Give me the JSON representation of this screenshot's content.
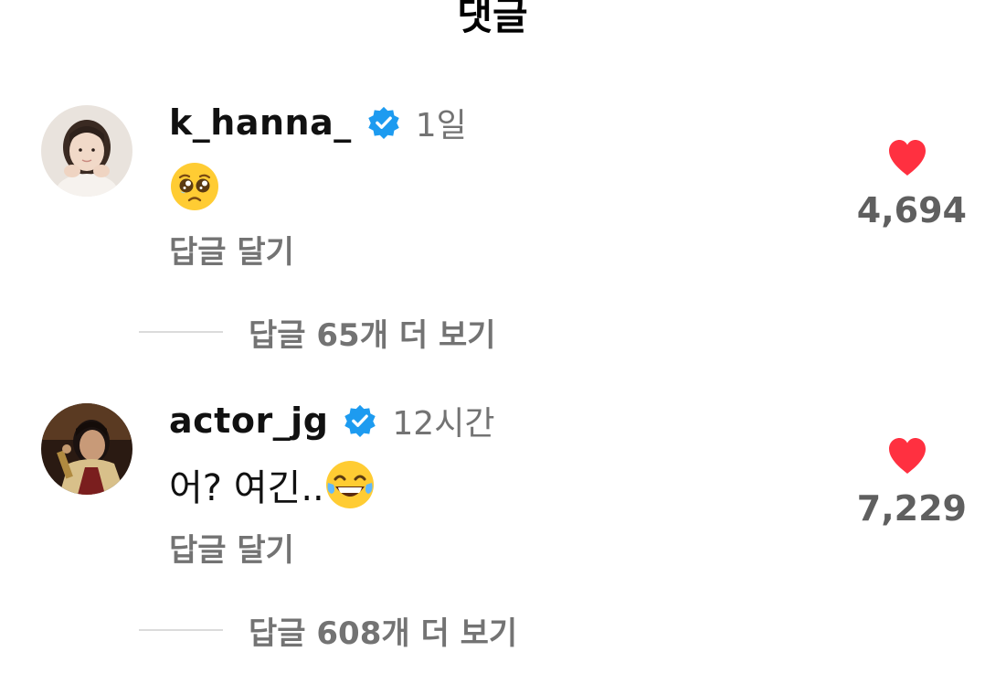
{
  "header": {
    "title": "댓글"
  },
  "comments": [
    {
      "username": "k_hanna_",
      "time": "1일",
      "text": "",
      "emoji": "pleading-face-emoji",
      "reply_label": "답글 달기",
      "likes": "4,694",
      "more_replies": "답글 65개 더 보기"
    },
    {
      "username": "actor_jg",
      "time": "12시간",
      "text": "어? 여긴..",
      "emoji": "tears-of-joy-emoji",
      "reply_label": "답글 달기",
      "likes": "7,229",
      "more_replies": "답글 608개 더 보기"
    }
  ],
  "colors": {
    "verified": "#1d9bf0",
    "heart": "#ff3040",
    "secondary_text": "#737373",
    "divider": "#dbdbdb"
  }
}
